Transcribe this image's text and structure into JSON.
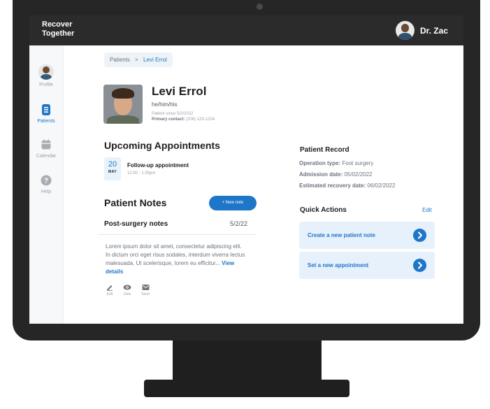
{
  "app": {
    "brand": "Recover Together"
  },
  "user": {
    "name": "Dr. Zac"
  },
  "sidebar": {
    "items": [
      {
        "label": "Profile"
      },
      {
        "label": "Patients"
      },
      {
        "label": "Calendar"
      },
      {
        "label": "Help"
      }
    ],
    "active": "Patients"
  },
  "breadcrumb": {
    "root": "Patients",
    "separator": ">",
    "current": "Levi Errol"
  },
  "patient": {
    "name": "Levi Errol",
    "pronouns": "he/him/his",
    "since": "Patient since 5/2/2022",
    "contact_label": "Primary contact:",
    "contact_value": "(206) 123-1234"
  },
  "appointments": {
    "title": "Upcoming Appointments",
    "items": [
      {
        "day": "20",
        "month": "MAY",
        "title": "Follow-up appointment",
        "time": "12:00 - 1:30pm"
      }
    ]
  },
  "notes": {
    "title": "Patient Notes",
    "new_button": "+ New note",
    "items": [
      {
        "title": "Post-surgery notes",
        "date": "5/2/22",
        "body": "Lorem ipsum dolor sit amet, consectetur adipiscing elit. In dictum orci eget risus sodales, interdum viverra lectus malesuada. Ut scelerisque, lorem eu efficitur...",
        "link": "View details"
      }
    ],
    "actions": [
      "Edit",
      "View",
      "Send"
    ]
  },
  "record": {
    "title": "Patient Record",
    "operation_label": "Operation type:",
    "operation_value": "Foot surgery",
    "admission_label": "Admission date:",
    "admission_value": "05/02/2022",
    "recovery_label": "Estimated recovery date:",
    "recovery_value": "06/02/2022"
  },
  "quick_actions": {
    "title": "Quick Actions",
    "edit": "Edit",
    "items": [
      {
        "label": "Create a new patient note"
      },
      {
        "label": "Set a new appointment"
      }
    ]
  },
  "colors": {
    "accent": "#1e76c9",
    "topbar": "#2b2b2b",
    "card": "#e7f1fb"
  }
}
